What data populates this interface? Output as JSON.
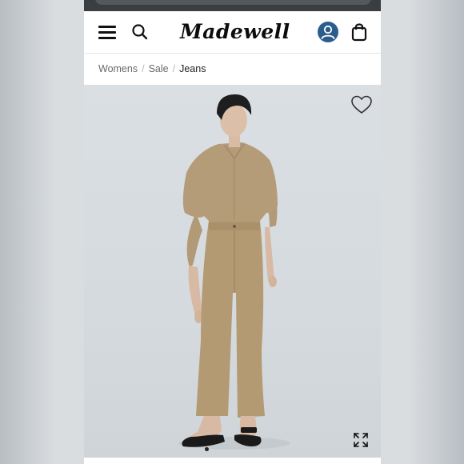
{
  "brand": {
    "logo_text": "Madewell"
  },
  "breadcrumb": {
    "items": [
      "Womens",
      "Sale"
    ],
    "current": "Jeans",
    "separator": "/"
  },
  "icons": {
    "menu": "hamburger-menu-icon",
    "search": "search-icon",
    "account": "user-account-icon",
    "bag": "shopping-bag-icon",
    "favorite": "heart-icon",
    "expand": "expand-icon"
  },
  "colors": {
    "account_bg": "#2b5d8c",
    "khaki": "#b49a72",
    "photo_bg": "#d7dce0"
  },
  "gallery": {
    "current_slide": 1
  }
}
